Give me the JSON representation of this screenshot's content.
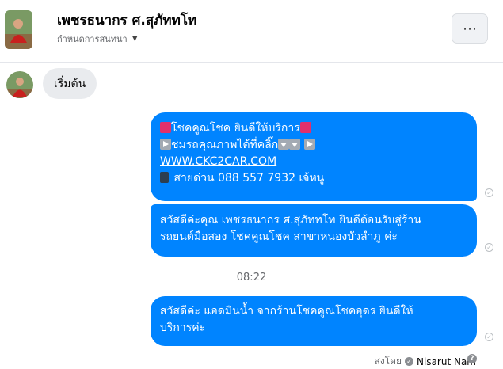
{
  "header": {
    "title": "เพชรธนากร ศ.สุภัททโท",
    "subtitle": "กำหนดการสนทนา",
    "more_icon": "more-horizontal-icon"
  },
  "messages": {
    "incoming": {
      "text": "เริ่มต้น"
    },
    "outgoing_1": {
      "line1": "โชคคูณโชค ยินดีให้บริการ",
      "line2": "ชมรถคุณภาพได้ที่คลิ๊ก",
      "link": "WWW.CKC2CAR.COM",
      "line4": "สายด่วน 088 557 7932 เจ้หนู"
    },
    "outgoing_2": {
      "line1": "สวัสดีค่ะคุณ เพชรธนากร ศ.สุภัททโท ยินดีต้อนรับสู่ร้าน",
      "line2": "รถยนต์มือสอง โชคคูณโชค สาขาหนองบัวลำภู ค่ะ"
    },
    "timestamp": "08:22",
    "outgoing_3": {
      "line1": "สวัสดีค่ะ แอดมินน้ำ จากร้านโชคคูณโชคอุดร ยินดีให้",
      "line2": "บริการค่ะ"
    }
  },
  "sent_by": {
    "label": "ส่งโดย",
    "name": "Nisarut Nam"
  },
  "colors": {
    "bubble_out": "#0084ff",
    "bubble_in": "#e9ebee"
  }
}
